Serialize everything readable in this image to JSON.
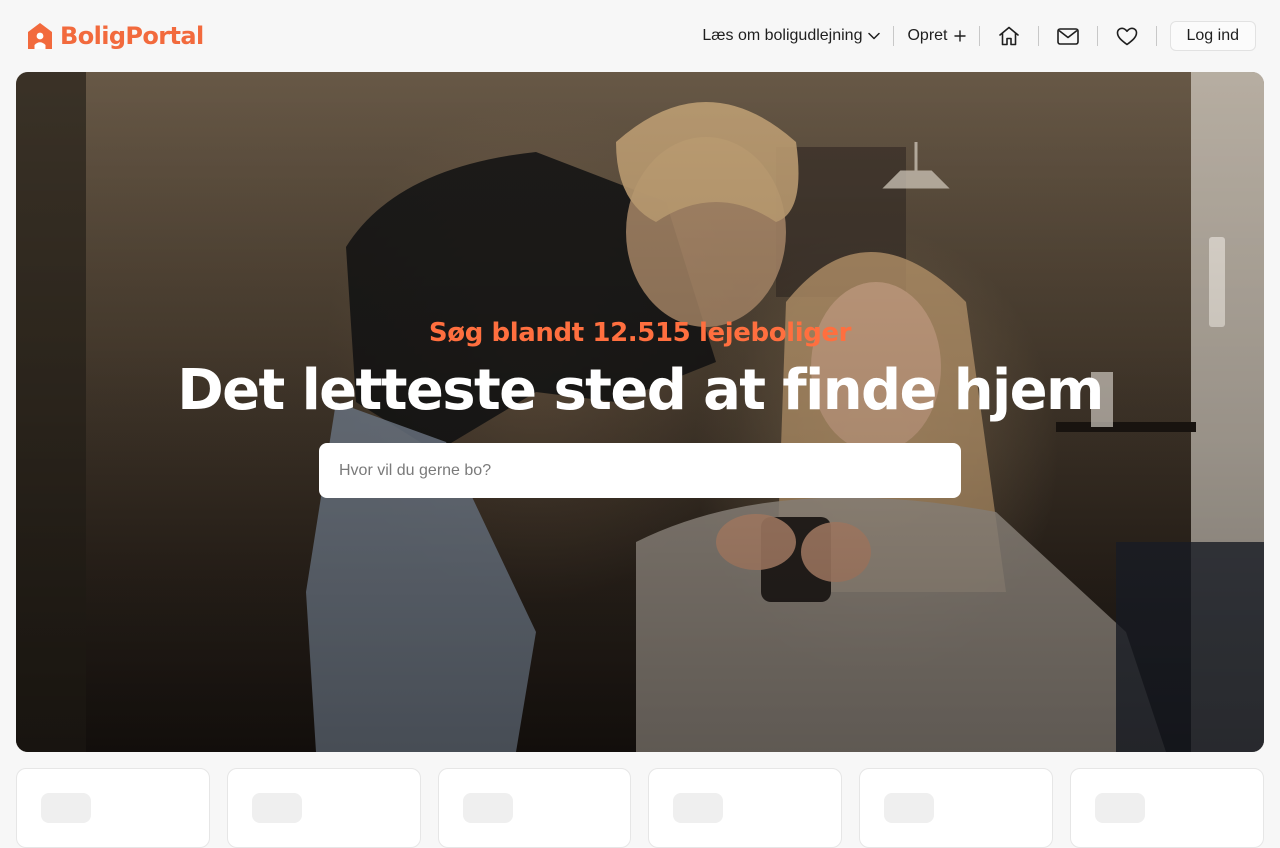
{
  "brand": {
    "name": "BoligPortal",
    "color": "#f26a3d",
    "icon": "house-logo-icon"
  },
  "nav": {
    "read_about": "Læs om boligudlejning",
    "create": "Opret",
    "icons": [
      "home-icon",
      "mail-icon",
      "heart-icon"
    ],
    "login": "Log ind"
  },
  "hero": {
    "kicker": "Søg blandt 12.515 lejeboliger",
    "title": "Det letteste sted at finde hjem",
    "search_placeholder": "Hvor vil du gerne bo?",
    "search_value": "",
    "accent_color": "#ff6f3f"
  },
  "cards": {
    "count": 6
  }
}
